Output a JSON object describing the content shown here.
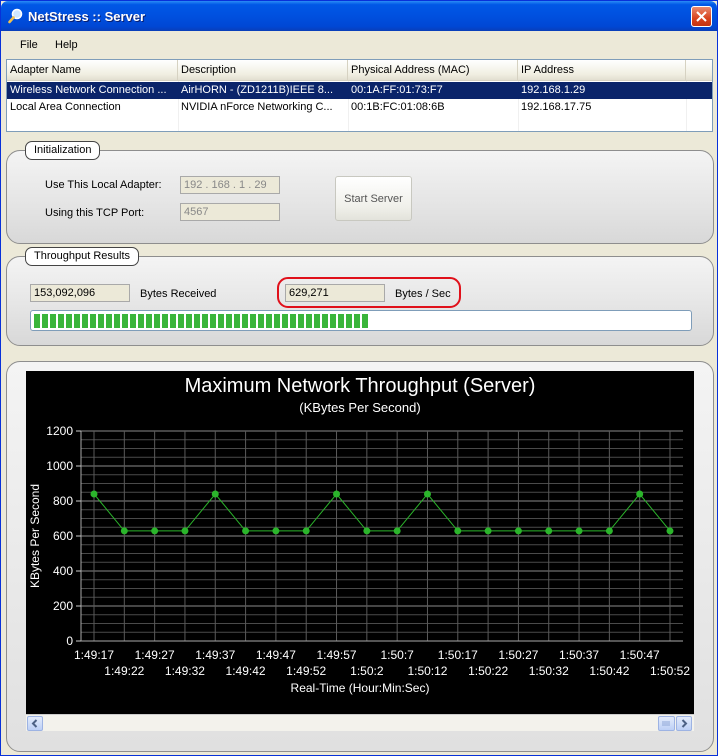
{
  "window": {
    "title": "NetStress :: Server",
    "icons": {
      "app": "magnifier-app-icon",
      "close": "close-icon"
    }
  },
  "menu": {
    "file": "File",
    "help": "Help"
  },
  "adapters": {
    "columns": [
      "Adapter Name",
      "Description",
      "Physical Address (MAC)",
      "IP Address"
    ],
    "rows": [
      {
        "name": "Wireless Network Connection ...",
        "description": "AirHORN - (ZD1211B)IEEE 8...",
        "mac": "00:1A:FF:01:73:F7",
        "ip": "192.168.1.29",
        "selected": true
      },
      {
        "name": "Local Area Connection",
        "description": "NVIDIA nForce Networking C...",
        "mac": "00:1B:FC:01:08:6B",
        "ip": "192.168.17.75",
        "selected": false
      }
    ]
  },
  "initialization": {
    "title": "Initialization",
    "adapter_label": "Use This Local Adapter:",
    "adapter_value": "192 . 168 .  1  . 29",
    "port_label": "Using this TCP Port:",
    "port_value": "4567",
    "start_button": "Start Server"
  },
  "throughput": {
    "title": "Throughput Results",
    "bytes_received_value": "153,092,096",
    "bytes_received_label": "Bytes Received",
    "rate_value": "629,271",
    "rate_label": "Bytes / Sec",
    "progress_fraction": 0.51,
    "progress_color": "#3AB53A",
    "highlight_color": "#E0101A"
  },
  "chart_data": {
    "type": "line",
    "title": "Maximum Network Throughput (Server)",
    "subtitle": "(KBytes Per Second)",
    "xlabel": "Real-Time (Hour:Min:Sec)",
    "ylabel": "KBytes Per Second",
    "ylim": [
      0,
      1200
    ],
    "yticks": [
      0,
      200,
      400,
      600,
      800,
      1000,
      1200
    ],
    "x": [
      "1:49:17",
      "1:49:22",
      "1:49:27",
      "1:49:32",
      "1:49:37",
      "1:49:42",
      "1:49:47",
      "1:49:52",
      "1:49:57",
      "1:50:2",
      "1:50:7",
      "1:50:12",
      "1:50:17",
      "1:50:22",
      "1:50:27",
      "1:50:32",
      "1:50:37",
      "1:50:42",
      "1:50:47",
      "1:50:52"
    ],
    "series": [
      {
        "values": [
          840,
          629,
          629,
          629,
          840,
          629,
          629,
          629,
          840,
          629,
          629,
          840,
          629,
          629,
          629,
          629,
          629,
          629,
          840,
          629
        ],
        "color": "#2BB52B"
      }
    ],
    "background": "#000000",
    "grid": true
  }
}
